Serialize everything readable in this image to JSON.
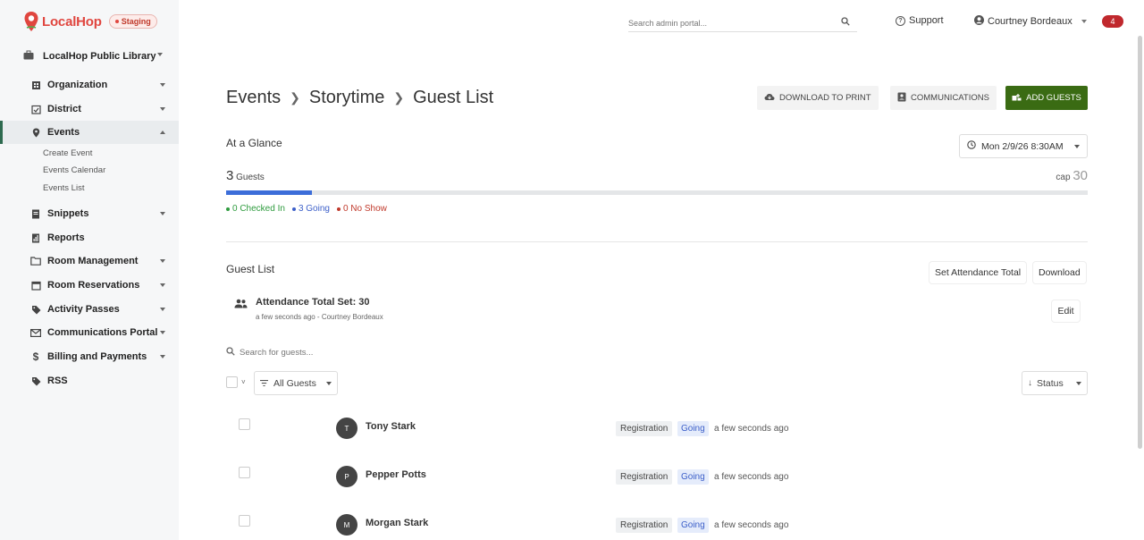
{
  "brand": {
    "name": "LocalHop",
    "env_badge": "Staging"
  },
  "sidebar": {
    "org": "LocalHop Public Library",
    "items": [
      {
        "label": "Organization",
        "icon": "building-icon",
        "has_caret": true
      },
      {
        "label": "District",
        "icon": "calendar-check-icon",
        "has_caret": true
      },
      {
        "label": "Events",
        "icon": "location-pin-icon",
        "has_caret": true,
        "active": true
      },
      {
        "label": "Snippets",
        "icon": "document-icon",
        "has_caret": true
      },
      {
        "label": "Reports",
        "icon": "report-icon",
        "has_caret": false
      },
      {
        "label": "Room Management",
        "icon": "folder-icon",
        "has_caret": true
      },
      {
        "label": "Room Reservations",
        "icon": "calendar-icon",
        "has_caret": true
      },
      {
        "label": "Activity Passes",
        "icon": "tag-icon",
        "has_caret": true
      },
      {
        "label": "Communications Portal",
        "icon": "mail-icon",
        "has_caret": true
      },
      {
        "label": "Billing and Payments",
        "icon": "dollar-icon",
        "has_caret": true
      },
      {
        "label": "RSS",
        "icon": "tag-icon",
        "has_caret": false
      }
    ],
    "sub_items": [
      "Create Event",
      "Events Calendar",
      "Events List"
    ]
  },
  "header": {
    "search_placeholder": "Search admin portal...",
    "support": "Support",
    "user": "Courtney Bordeaux",
    "notifications": "4"
  },
  "page": {
    "breadcrumb": [
      "Events",
      "Storytime",
      "Guest List"
    ],
    "actions": {
      "download_print": "DOWNLOAD TO PRINT",
      "communications": "COMMUNICATIONS",
      "add_guests": "ADD GUESTS"
    },
    "glance": {
      "title": "At a Glance",
      "date": "Mon 2/9/26 8:30AM",
      "guest_count": "3",
      "guests_label": "Guests",
      "cap_label": "cap",
      "cap_value": "30",
      "progress_fraction": 0.1,
      "checked_in": "0 Checked In",
      "going": "3 Going",
      "no_show": "0 No Show"
    },
    "guest_list": {
      "title": "Guest List",
      "set_attendance": "Set Attendance Total",
      "download": "Download",
      "attendance_title": "Attendance Total Set: 30",
      "attendance_sub": "a few seconds ago - Courtney Bordeaux",
      "edit": "Edit",
      "search_placeholder": "Search for guests...",
      "filter": "All Guests",
      "status_filter": "Status",
      "guests": [
        {
          "initial": "T",
          "name": "Tony Stark",
          "type": "Registration",
          "status": "Going",
          "time": "a few seconds ago"
        },
        {
          "initial": "P",
          "name": "Pepper Potts",
          "type": "Registration",
          "status": "Going",
          "time": "a few seconds ago"
        },
        {
          "initial": "M",
          "name": "Morgan Stark",
          "type": "Registration",
          "status": "Going",
          "time": "a few seconds ago"
        }
      ]
    }
  },
  "colors": {
    "brand_red": "#e0463f",
    "add_green": "#3a6b13",
    "progress_blue": "#3c6dd9",
    "checked_in_green": "#2e9b3e",
    "going_blue": "#3c5fc9",
    "no_show_red": "#c0392b"
  }
}
